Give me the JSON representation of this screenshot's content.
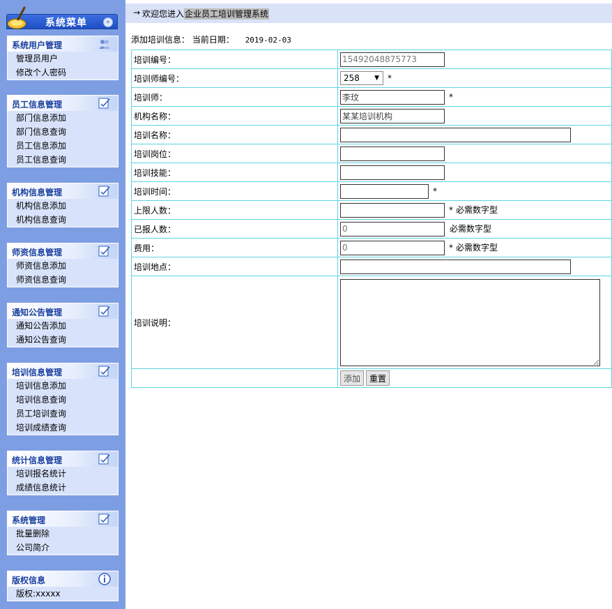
{
  "sidebar": {
    "title": "系统菜单",
    "collapse_glyph": "»",
    "groups": [
      {
        "title": "系统用户管理",
        "icon": "users-icon",
        "items": [
          "管理员用户",
          "修改个人密码"
        ]
      },
      {
        "title": "员工信息管理",
        "icon": "edit-icon",
        "items": [
          "部门信息添加",
          "部门信息查询",
          "员工信息添加",
          "员工信息查询"
        ]
      },
      {
        "title": "机构信息管理",
        "icon": "edit-icon",
        "items": [
          "机构信息添加",
          "机构信息查询"
        ]
      },
      {
        "title": "师资信息管理",
        "icon": "edit-icon",
        "items": [
          "师资信息添加",
          "师资信息查询"
        ]
      },
      {
        "title": "通知公告管理",
        "icon": "edit-icon",
        "items": [
          "通知公告添加",
          "通知公告查询"
        ]
      },
      {
        "title": "培训信息管理",
        "icon": "edit-icon",
        "items": [
          "培训信息添加",
          "培训信息查询",
          "员工培训查询",
          "培训成绩查询"
        ]
      },
      {
        "title": "统计信息管理",
        "icon": "edit-icon",
        "items": [
          "培训报名统计",
          "成绩信息统计"
        ]
      },
      {
        "title": "系统管理",
        "icon": "edit-icon",
        "items": [
          "批量删除",
          "公司简介"
        ]
      },
      {
        "title": "版权信息",
        "icon": "info-icon",
        "items": [
          "版权:xxxxx"
        ]
      }
    ]
  },
  "topbar": {
    "arrow": "→",
    "welcome_prefix": "欢迎您进入",
    "system_name": "企业员工培训管理系统"
  },
  "info": {
    "label": "添加培训信息：",
    "date_label": "当前日期：",
    "date": "2019-02-03"
  },
  "form": {
    "rows": [
      {
        "label": "培训编号：",
        "value": "15492048875773",
        "placeholder": ""
      },
      {
        "label": "培训师编号：",
        "value": "258",
        "star": "*"
      },
      {
        "label": "培训师：",
        "value": "李玟",
        "star": "*"
      },
      {
        "label": "机构名称：",
        "value": "某某培训机构"
      },
      {
        "label": "培训名称：",
        "value": ""
      },
      {
        "label": "培训岗位：",
        "value": ""
      },
      {
        "label": "培训技能：",
        "value": ""
      },
      {
        "label": "培训时间：",
        "value": "",
        "star": "*"
      },
      {
        "label": "上限人数：",
        "value": "",
        "star": "*",
        "hint": "必需数字型"
      },
      {
        "label": "已报人数：",
        "value": "0",
        "hint": "必需数字型"
      },
      {
        "label": "费用：",
        "value": "0",
        "star": "*",
        "hint": "必需数字型"
      },
      {
        "label": "培训地点：",
        "value": ""
      },
      {
        "label": "培训说明：",
        "value": ""
      }
    ],
    "add_label": "添加",
    "reset_label": "重置"
  }
}
